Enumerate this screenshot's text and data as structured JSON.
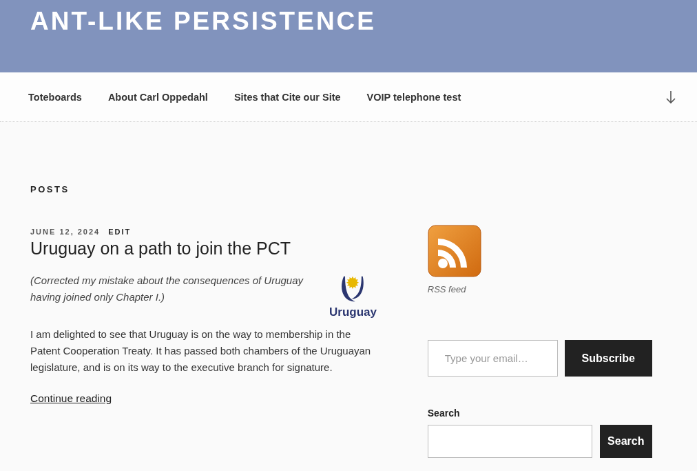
{
  "site": {
    "title": "ANT-LIKE PERSISTENCE"
  },
  "nav": {
    "items": [
      "Toteboards",
      "About Carl Oppedahl",
      "Sites that Cite our Site",
      "VOIP telephone test"
    ]
  },
  "section_title": "POSTS",
  "post": {
    "date": "JUNE 12, 2024",
    "edit": "EDIT",
    "title": "Uruguay on a path to join the PCT",
    "note": "(Corrected my mistake about the consequences of Uruguay having joined only Chapter I.)",
    "logo_text": "Uruguay",
    "body": "I am delighted to see that Uruguay is on the way to membership in the Patent Cooperation Treaty.  It has passed both chambers of the Uruguayan legislature, and is on its way to the executive branch for signature.",
    "more": "Continue reading"
  },
  "sidebar": {
    "rss_caption": "RSS feed",
    "email": {
      "placeholder": "Type your email…"
    },
    "subscribe": "Subscribe",
    "search_label": "Search",
    "search_button": "Search"
  }
}
